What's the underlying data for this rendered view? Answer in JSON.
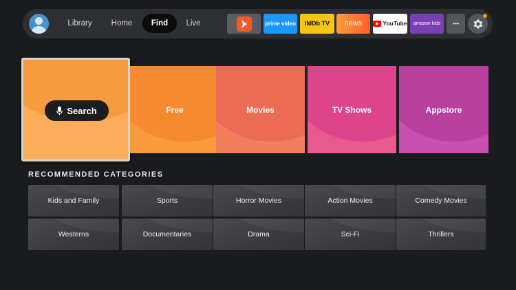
{
  "nav": {
    "items": [
      {
        "label": "Library",
        "active": false
      },
      {
        "label": "Home",
        "active": false
      },
      {
        "label": "Find",
        "active": true
      },
      {
        "label": "Live",
        "active": false
      }
    ],
    "apps": [
      {
        "name": "app-icon-orange-arrow",
        "label": "",
        "bg": "#5a5c60"
      },
      {
        "name": "prime-video-app",
        "label": "prime video",
        "bg": "#1a98ff"
      },
      {
        "name": "imdb-tv-app",
        "label": "IMDb TV",
        "bg": "#f5c518"
      },
      {
        "name": "news-app",
        "label": "news",
        "bg": "#ff7a2c"
      },
      {
        "name": "youtube-app",
        "label": "YouTube",
        "bg": "#ffffff"
      },
      {
        "name": "amazon-kids-app",
        "label": "amazon kids",
        "bg": "#7b3fb5"
      },
      {
        "name": "more-apps",
        "label": "•••",
        "bg": "#54565a"
      }
    ]
  },
  "tiles": {
    "search_label": "Search",
    "items": [
      {
        "label": "Free",
        "bg": "#fb9a3a",
        "accent": "#f68428"
      },
      {
        "label": "Movies",
        "bg": "#f07a5a",
        "accent": "#ec6a54"
      },
      {
        "label": "TV Shows",
        "bg": "#e65a8a",
        "accent": "#e0468c"
      },
      {
        "label": "Appstore",
        "bg": "#c84fb0",
        "accent": "#b8409e"
      }
    ]
  },
  "recommended": {
    "title": "RECOMMENDED CATEGORIES",
    "categories": [
      "Kids and Family",
      "Sports",
      "Horror Movies",
      "Action Movies",
      "Comedy Movies",
      "Westerns",
      "Documentaries",
      "Drama",
      "Sci-Fi",
      "Thrillers"
    ]
  },
  "colors": {
    "background": "#1a1b1e",
    "navbar": "#2d2f33",
    "notification": "#ff9500"
  }
}
